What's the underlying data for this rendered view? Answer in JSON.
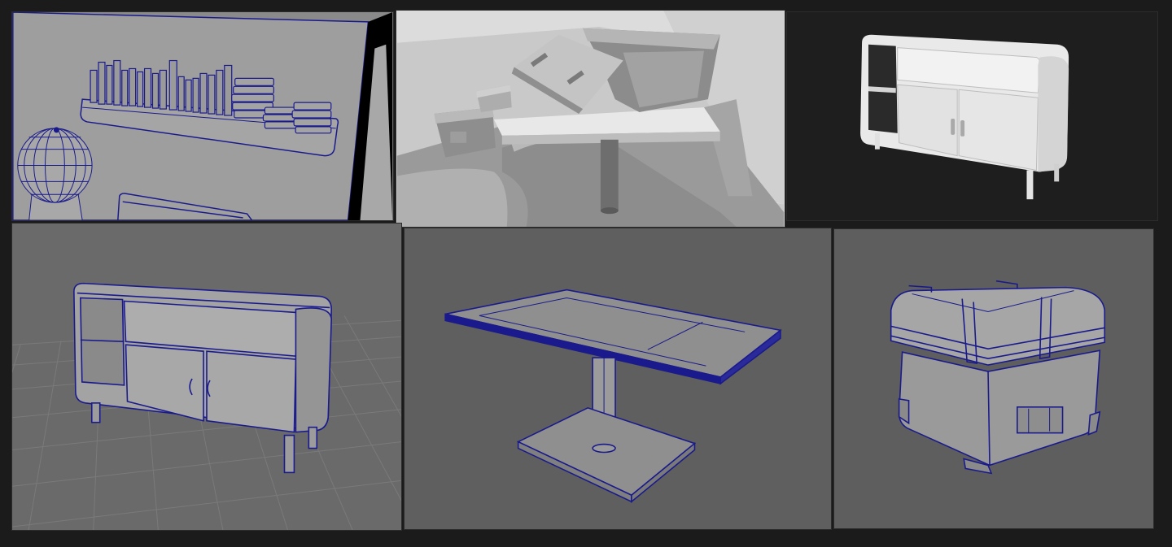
{
  "image_title": "",
  "panels": [
    {
      "name": "bookshelf-wireframe-panel",
      "render": "wireframe",
      "subject": "wall-shelf-with-books"
    },
    {
      "name": "room-scene-render-panel",
      "render": "shaded",
      "subject": "table-with-crates"
    },
    {
      "name": "sideboard-render-panel",
      "render": "shaded",
      "subject": "sideboard-cabinet"
    },
    {
      "name": "sideboard-wireframe-panel",
      "render": "wireframe",
      "subject": "sideboard-cabinet"
    },
    {
      "name": "table-wireframe-panel",
      "render": "wireframe",
      "subject": "pedestal-table"
    },
    {
      "name": "crate-wireframe-panel",
      "render": "wireframe",
      "subject": "storage-crate"
    }
  ],
  "colors": {
    "background": "#1b1b1b",
    "wire_blue": "#1a1a8c",
    "model_gray": "#9a9a9a",
    "viewport_gray": "#5f5f5f",
    "render_white": "#e6e6e6"
  }
}
